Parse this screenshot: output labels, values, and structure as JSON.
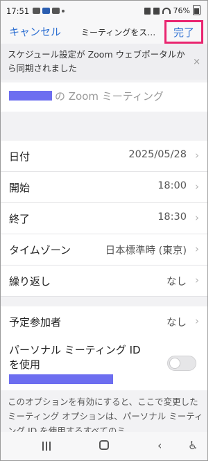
{
  "status_bar": {
    "time": "17:51",
    "battery": "76%"
  },
  "nav": {
    "cancel_label": "キャンセル",
    "title": "ミーティングをス…",
    "done_label": "完了"
  },
  "banner": {
    "text": "スケジュール設定が Zoom ウェブポータルから同期されました",
    "close_icon": "×"
  },
  "topic": {
    "suffix": "の Zoom ミーティング"
  },
  "rows": [
    {
      "label": "日付",
      "value": "2025/05/28"
    },
    {
      "label": "開始",
      "value": "18:00"
    },
    {
      "label": "終了",
      "value": "18:30"
    },
    {
      "label": "タイムゾーン",
      "value": "日本標準時 (東京)"
    },
    {
      "label": "繰り返し",
      "value": "なし"
    }
  ],
  "attendees": {
    "label": "予定参加者",
    "value": "なし"
  },
  "pmi": {
    "label": "パーソナル ミーティング ID を使用",
    "enabled": false
  },
  "description": "このオプションを有効にすると、ここで変更したミーティング オプションは、パーソナル ミーティング ID を使用するすべてのミ",
  "chevron": "›",
  "bottom_nav": {
    "back": "‹",
    "access": "♿"
  },
  "colors": {
    "accent": "#2d6fd2",
    "highlight": "#e9246f",
    "redaction": "#6d6ef0"
  }
}
